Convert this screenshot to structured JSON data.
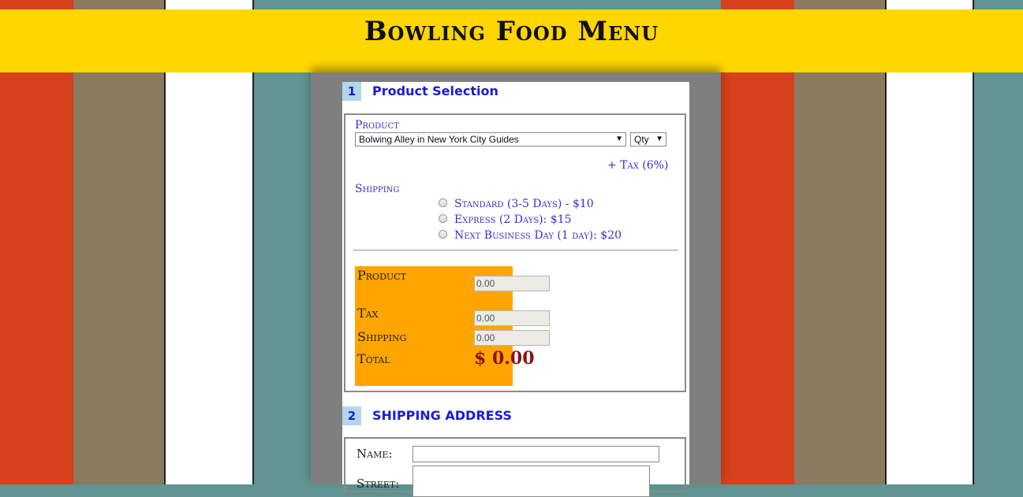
{
  "page": {
    "title": "Bowling Food Menu"
  },
  "stripe_colors": {
    "red": "#d6401a",
    "tan": "#8a7a5e",
    "white": "#ffffff",
    "teal": "#5f9491",
    "yellow": "#ffd700",
    "gray": "#7f7f7f"
  },
  "step1": {
    "number": "1",
    "title": "Product Selection",
    "product_label": "Product",
    "product_select_value": "Bolwing Alley in New York City Guides",
    "qty_select_value": "Qty",
    "tax_note": "+ Tax (6%)",
    "shipping_label": "Shipping",
    "shipping_options": [
      "Standard (3-5 Days) - $10",
      "Express (2 Days): $15",
      "Next Business Day (1 day): $20"
    ],
    "summary": {
      "product_label": "Product",
      "product_value": "0.00",
      "tax_label": "Tax",
      "tax_value": "0.00",
      "shipping_label": "Shipping",
      "shipping_value": "0.00",
      "total_label": "Total",
      "total_value": "$ 0.00"
    }
  },
  "step2": {
    "number": "2",
    "title": "SHIPPING ADDRESS",
    "name_label": "Name:",
    "street_label": "Street:"
  }
}
